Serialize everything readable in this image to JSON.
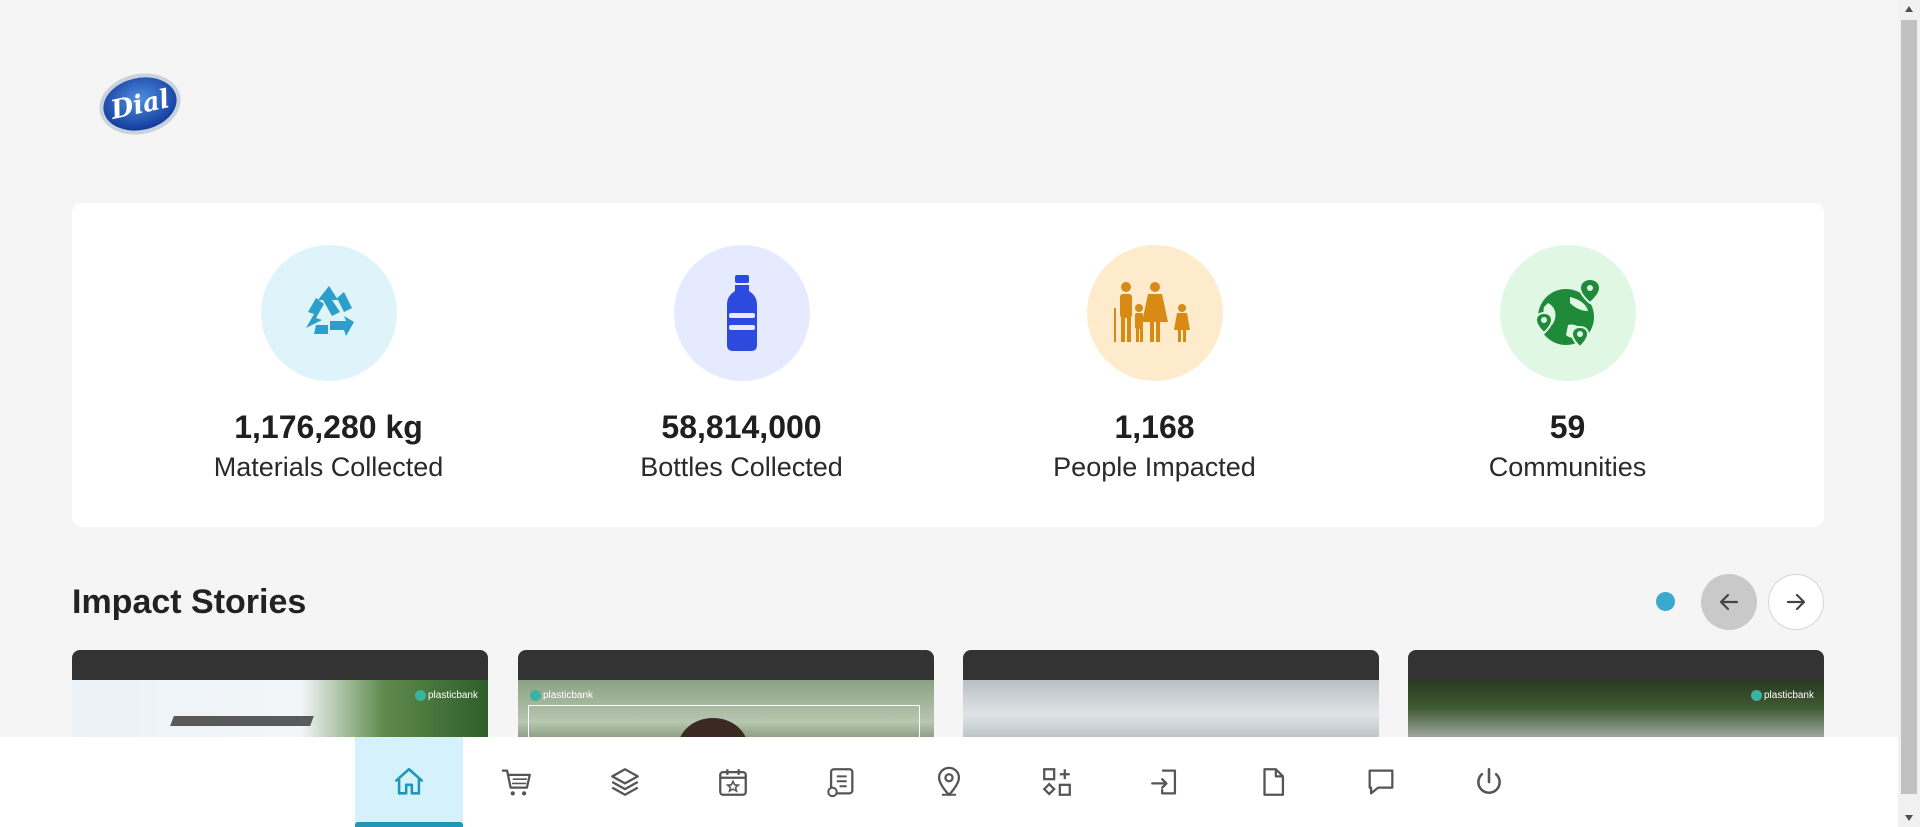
{
  "brand": {
    "logo_text": "Dial"
  },
  "stats": [
    {
      "value": "1,176,280 kg",
      "label": "Materials Collected",
      "icon": "recycle-icon",
      "bg": "#dff3fb",
      "color": "#2a9fc9"
    },
    {
      "value": "58,814,000",
      "label": "Bottles Collected",
      "icon": "bottle-icon",
      "bg": "#e5eaff",
      "color": "#2d4ae0"
    },
    {
      "value": "1,168",
      "label": "People Impacted",
      "icon": "family-icon",
      "bg": "#fdebcc",
      "color": "#d98a14"
    },
    {
      "value": "59",
      "label": "Communities",
      "icon": "globe-pins-icon",
      "bg": "#e0f8e3",
      "color": "#1f8a3a"
    }
  ],
  "impact_stories": {
    "title": "Impact Stories",
    "watermark": "plasticbank"
  },
  "bottom_nav": [
    {
      "name": "home",
      "icon": "home-icon",
      "active": true
    },
    {
      "name": "shop",
      "icon": "cart-icon",
      "active": false
    },
    {
      "name": "layers",
      "icon": "layers-icon",
      "active": false
    },
    {
      "name": "events",
      "icon": "calendar-star-icon",
      "active": false
    },
    {
      "name": "reports",
      "icon": "document-list-icon",
      "active": false
    },
    {
      "name": "locations",
      "icon": "map-pin-icon",
      "active": false
    },
    {
      "name": "apps",
      "icon": "shapes-plus-icon",
      "active": false
    },
    {
      "name": "login",
      "icon": "login-icon",
      "active": false
    },
    {
      "name": "files",
      "icon": "file-icon",
      "active": false
    },
    {
      "name": "messages",
      "icon": "chat-icon",
      "active": false
    },
    {
      "name": "logout",
      "icon": "power-icon",
      "active": false
    }
  ],
  "colors": {
    "accent": "#2196b8",
    "active_tab_bg": "#d5f1fb",
    "page_bg": "#f5f5f5",
    "dot": "#3aa8cf"
  }
}
